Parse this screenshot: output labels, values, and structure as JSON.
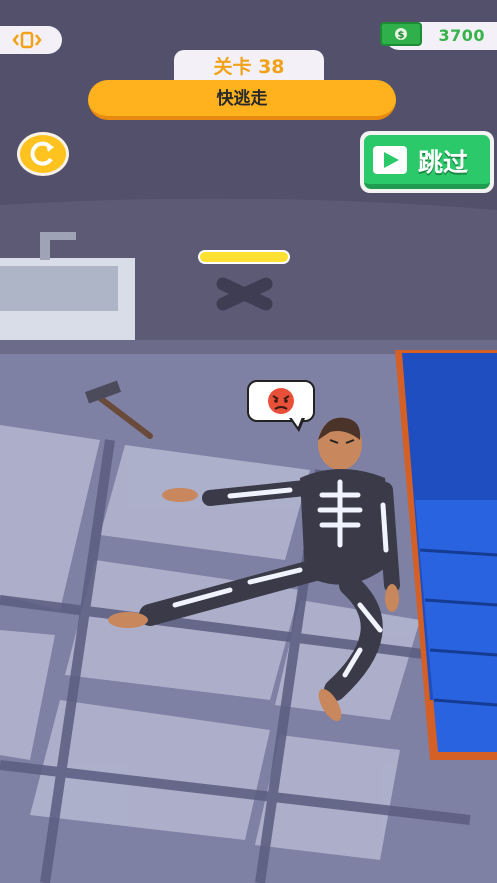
{
  "hud": {
    "money_value": "3700",
    "level_label": "关卡 38",
    "task_label": "快逃走",
    "skip_label": "跳过",
    "progress": 1.0
  },
  "scene": {
    "character_emotion": "angry-face",
    "objects": [
      "sink",
      "hammer",
      "bed",
      "x-floor-mark",
      "character-skeleton-pajamas"
    ]
  },
  "colors": {
    "accent_orange": "#ffb21d",
    "skip_green": "#2bc96a",
    "money_green": "#38b34c",
    "level_text": "#f2a21a"
  }
}
